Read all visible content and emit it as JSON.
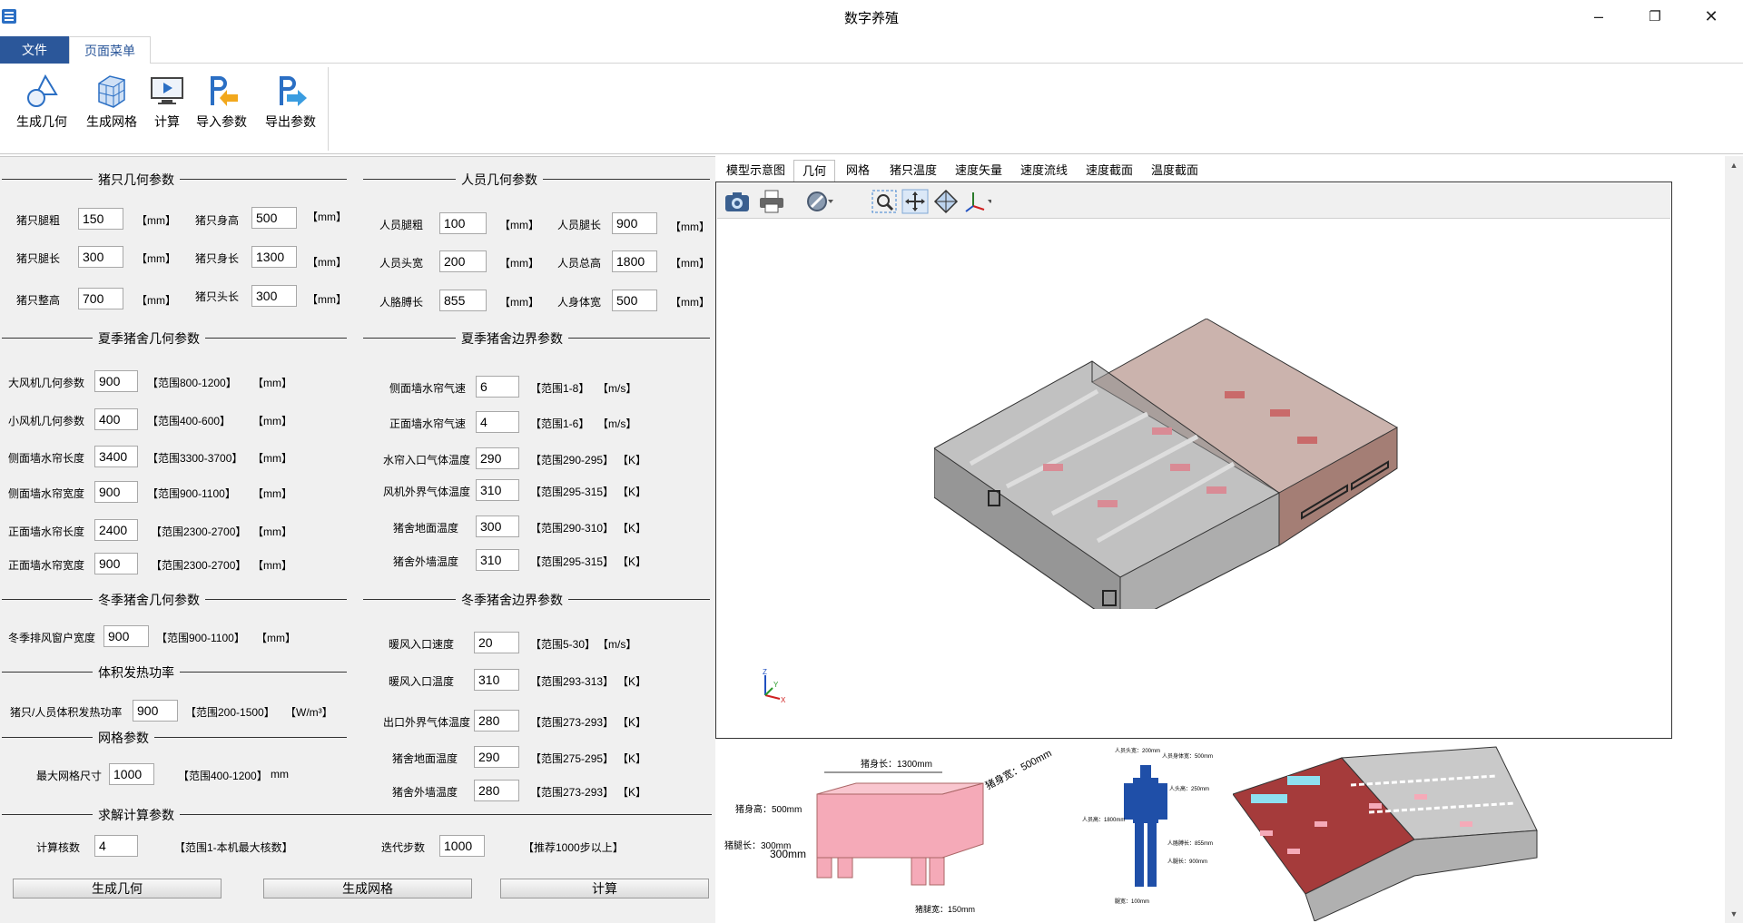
{
  "window": {
    "title": "数字养殖",
    "minimize": "–",
    "restore": "❐",
    "close": "✕"
  },
  "menu": {
    "tabs": [
      "文件",
      "页面菜单"
    ]
  },
  "ribbon": {
    "buttons": [
      "生成几何",
      "生成网格",
      "计算",
      "导入参数",
      "导出参数"
    ]
  },
  "pig_geom": {
    "title": "猪只几何参数",
    "fields": [
      {
        "label": "猪只腿粗",
        "value": "150",
        "unit": "【mm】"
      },
      {
        "label": "猪只身高",
        "value": "500",
        "unit": "【mm】"
      },
      {
        "label": "猪只腿长",
        "value": "300",
        "unit": "【mm】"
      },
      {
        "label": "猪只身长",
        "value": "1300",
        "unit": "【mm】"
      },
      {
        "label": "猪只整高",
        "value": "700",
        "unit": "【mm】"
      },
      {
        "label": "猪只头长",
        "value": "300",
        "unit": "【mm】"
      }
    ]
  },
  "person_geom": {
    "title": "人员几何参数",
    "fields": [
      {
        "label": "人员腿粗",
        "value": "100",
        "unit": "【mm】"
      },
      {
        "label": "人员腿长",
        "value": "900",
        "unit": "【mm】"
      },
      {
        "label": "人员头宽",
        "value": "200",
        "unit": "【mm】"
      },
      {
        "label": "人员总高",
        "value": "1800",
        "unit": "【mm】"
      },
      {
        "label": "人胳膊长",
        "value": "855",
        "unit": "【mm】"
      },
      {
        "label": "人身体宽",
        "value": "500",
        "unit": "【mm】"
      }
    ]
  },
  "summer_geom": {
    "title": "夏季猪舍几何参数",
    "fields": [
      {
        "label": "大风机几何参数",
        "value": "900",
        "range": "【范围800-1200】",
        "unit": "【mm】"
      },
      {
        "label": "小风机几何参数",
        "value": "400",
        "range": "【范围400-600】",
        "unit": "【mm】"
      },
      {
        "label": "侧面墙水帘长度",
        "value": "3400",
        "range": "【范围3300-3700】",
        "unit": "【mm】"
      },
      {
        "label": "侧面墙水帘宽度",
        "value": "900",
        "range": "【范围900-1100】",
        "unit": "【mm】"
      },
      {
        "label": "正面墙水帘长度",
        "value": "2400",
        "range": "【范围2300-2700】",
        "unit": "【mm】"
      },
      {
        "label": "正面墙水帘宽度",
        "value": "900",
        "range": "【范围2300-2700】",
        "unit": "【mm】"
      }
    ]
  },
  "summer_bc": {
    "title": "夏季猪舍边界参数",
    "fields": [
      {
        "label": "侧面墙水帘气速",
        "value": "6",
        "range": "【范围1-8】",
        "unit": "【m/s】"
      },
      {
        "label": "正面墙水帘气速",
        "value": "4",
        "range": "【范围1-6】",
        "unit": "【m/s】"
      },
      {
        "label": "水帘入口气体温度",
        "value": "290",
        "range": "【范围290-295】",
        "unit": "【K】"
      },
      {
        "label": "风机外界气体温度",
        "value": "310",
        "range": "【范围295-315】",
        "unit": "【K】"
      },
      {
        "label": "猪舍地面温度",
        "value": "300",
        "range": "【范围290-310】",
        "unit": "【K】"
      },
      {
        "label": "猪舍外墙温度",
        "value": "310",
        "range": "【范围295-315】",
        "unit": "【K】"
      }
    ]
  },
  "winter_geom": {
    "title": "冬季猪舍几何参数",
    "fields": [
      {
        "label": "冬季排风窗户宽度",
        "value": "900",
        "range": "【范围900-1100】",
        "unit": "【mm】"
      }
    ]
  },
  "heat": {
    "title": "体积发热功率",
    "fields": [
      {
        "label": "猪只/人员体积发热功率",
        "value": "900",
        "range": "【范围200-1500】",
        "unit": "【W/m³】"
      }
    ]
  },
  "mesh": {
    "title": "网格参数",
    "fields": [
      {
        "label": "最大网格尺寸",
        "value": "1000",
        "range": "【范围400-1200】",
        "unit": "mm"
      }
    ]
  },
  "winter_bc": {
    "title": "冬季猪舍边界参数",
    "fields": [
      {
        "label": "暖风入口速度",
        "value": "20",
        "range": "【范围5-30】",
        "unit": "【m/s】"
      },
      {
        "label": "暖风入口温度",
        "value": "310",
        "range": "【范围293-313】",
        "unit": "【K】"
      },
      {
        "label": "出口外界气体温度",
        "value": "280",
        "range": "【范围273-293】",
        "unit": "【K】"
      },
      {
        "label": "猪舍地面温度",
        "value": "290",
        "range": "【范围275-295】",
        "unit": "【K】"
      },
      {
        "label": "猪舍外墙温度",
        "value": "280",
        "range": "【范围273-293】",
        "unit": "【K】"
      }
    ]
  },
  "solver": {
    "title": "求解计算参数",
    "cores_label": "计算核数",
    "cores_value": "4",
    "cores_range": "【范围1-本机最大核数】",
    "steps_label": "迭代步数",
    "steps_value": "1000",
    "steps_note": "【推荐1000步以上】"
  },
  "actions": [
    "生成几何",
    "生成网格",
    "计算"
  ],
  "viewer": {
    "tabs": [
      "模型示意图",
      "几何",
      "网格",
      "猪只温度",
      "速度矢量",
      "速度流线",
      "速度截面",
      "温度截面"
    ],
    "active_tab": "几何",
    "axis": {
      "x": "X",
      "y": "Y",
      "z": "Z"
    }
  },
  "diagrams": {
    "pig": {
      "body_length": "猪身长：1300mm",
      "body_width": "猪身宽：500mm",
      "body_height": "猪身高：500mm",
      "leg_length": "猪腿长：300mm",
      "leg_width": "猪腿宽：150mm",
      "small_dim": "300mm"
    },
    "person": {
      "head_width": "人员头宽：200mm",
      "body_width": "人员身体宽：500mm",
      "head_height": "人头高：250mm",
      "total_height": "人员高：1800mm",
      "arm": "人胳膊长：855mm",
      "leg": "人腿长：900mm",
      "leg_width": "腿宽：100mm"
    }
  }
}
